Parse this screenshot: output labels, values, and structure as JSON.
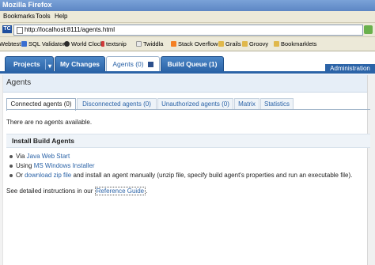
{
  "window": {
    "title": "Mozilla Firefox"
  },
  "menu": {
    "bookmarks": "Bookmarks",
    "tools": "Tools",
    "help": "Help"
  },
  "nav": {
    "favicon": "TC",
    "url": "http://localhost:8111/agents.html"
  },
  "bookmarks_bar": [
    {
      "label": "Webtest",
      "icon_color": "#d9d2b6"
    },
    {
      "label": "SQL Validator",
      "icon_color": "#3a6fd1"
    },
    {
      "label": "World Clock",
      "icon_color": "#2a2a2a"
    },
    {
      "label": "textsnip",
      "icon_color": "#d13b3b"
    },
    {
      "label": "Twiddla",
      "icon_color": "#e8e8e8"
    },
    {
      "label": "Stack Overflow",
      "icon_color": "#f48024"
    },
    {
      "label": "Grails",
      "icon_color": "#e0b84b"
    },
    {
      "label": "Groovy",
      "icon_color": "#e0b84b"
    },
    {
      "label": "Bookmarklets",
      "icon_color": "#e0b84b"
    }
  ],
  "tabs": {
    "projects": "Projects",
    "my_changes": "My Changes",
    "agents": "Agents (0)",
    "build_queue": "Build Queue (1)",
    "administration": "Administration"
  },
  "page": {
    "title": "Agents"
  },
  "subtabs": [
    "Connected agents (0)",
    "Disconnected agents (0)",
    "Unauthorized agents (0)",
    "Matrix",
    "Statistics"
  ],
  "content": {
    "no_agents": "There are no agents available.",
    "install_header": "Install Build Agents",
    "item1_prefix": "Via ",
    "item1_link": "Java Web Start",
    "item2_prefix": "Using ",
    "item2_link": "MS Windows Installer",
    "item3_prefix": "Or ",
    "item3_link": "download zip file",
    "item3_suffix": " and install an agent manually (unzip file, specify build agent's properties and run an executable file).",
    "see_prefix": "See detailed instructions in our ",
    "see_link": "Reference Guide",
    "see_suffix": "."
  },
  "colors": {
    "accent": "#2b63a7",
    "breadcrumb_bg": "#e6eef7"
  }
}
